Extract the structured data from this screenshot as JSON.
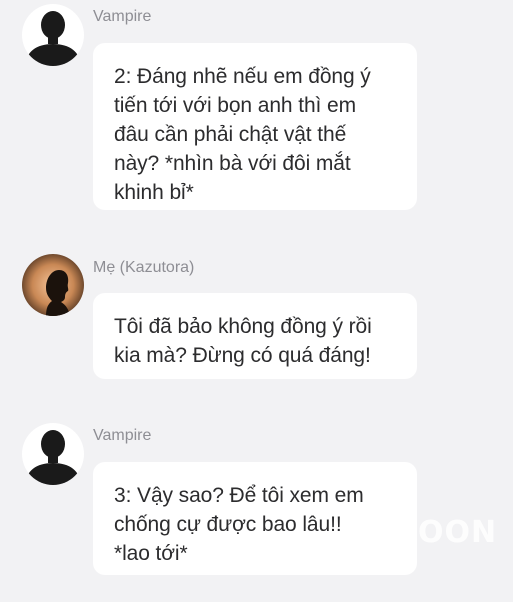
{
  "messages": [
    {
      "sender": "Vampire",
      "avatar_icon": "silhouette-avatar-icon",
      "text": "2: Đáng nhẽ nếu em đồng ý\ntiến tới với bọn anh thì em\nđâu cần phải chật vật thế\nnày? *nhìn bà với đôi mắt\nkhinh bỉ*"
    },
    {
      "sender": "Mẹ (Kazutora)",
      "avatar_icon": "profile-silhouette-avatar-icon",
      "text": "Tôi đã bảo không đồng ý rồi\nkia mà? Đừng có quá đáng!"
    },
    {
      "sender": "Vampire",
      "avatar_icon": "silhouette-avatar-icon",
      "text": "3: Vậy sao? Để tôi xem em\nchống cự được bao lâu!!\n*lao tới*"
    }
  ],
  "watermark": "OON",
  "colors": {
    "background": "#f2f2f4",
    "bubble": "#ffffff",
    "sender_name": "#8e8e94",
    "message_text": "#2c2c2e"
  }
}
